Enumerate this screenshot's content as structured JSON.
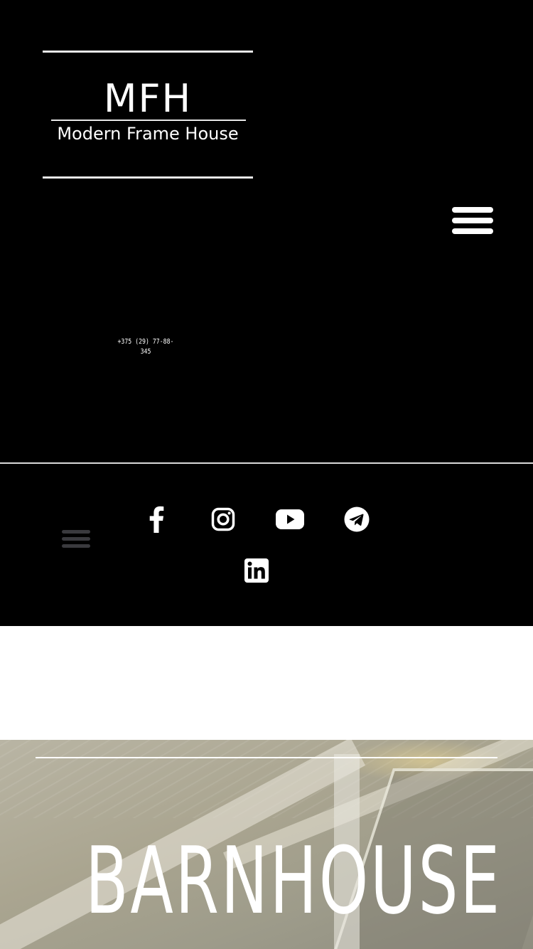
{
  "header": {
    "logo": {
      "abbreviation": "MFH",
      "full_name": "Modern Frame House"
    },
    "menu_icon": "hamburger-menu-icon",
    "phone": "+375 (29) 77-88-345"
  },
  "social": {
    "menu_icon": "hamburger-menu-icon",
    "links": [
      {
        "icon": "facebook-icon"
      },
      {
        "icon": "instagram-icon"
      },
      {
        "icon": "youtube-icon"
      },
      {
        "icon": "telegram-icon"
      },
      {
        "icon": "linkedin-icon"
      }
    ]
  },
  "hero": {
    "title": "BARNHOUSE"
  },
  "colors": {
    "background_dark": "#000000",
    "text_light": "#ffffff",
    "menu_dim": "#3a3a3e"
  }
}
